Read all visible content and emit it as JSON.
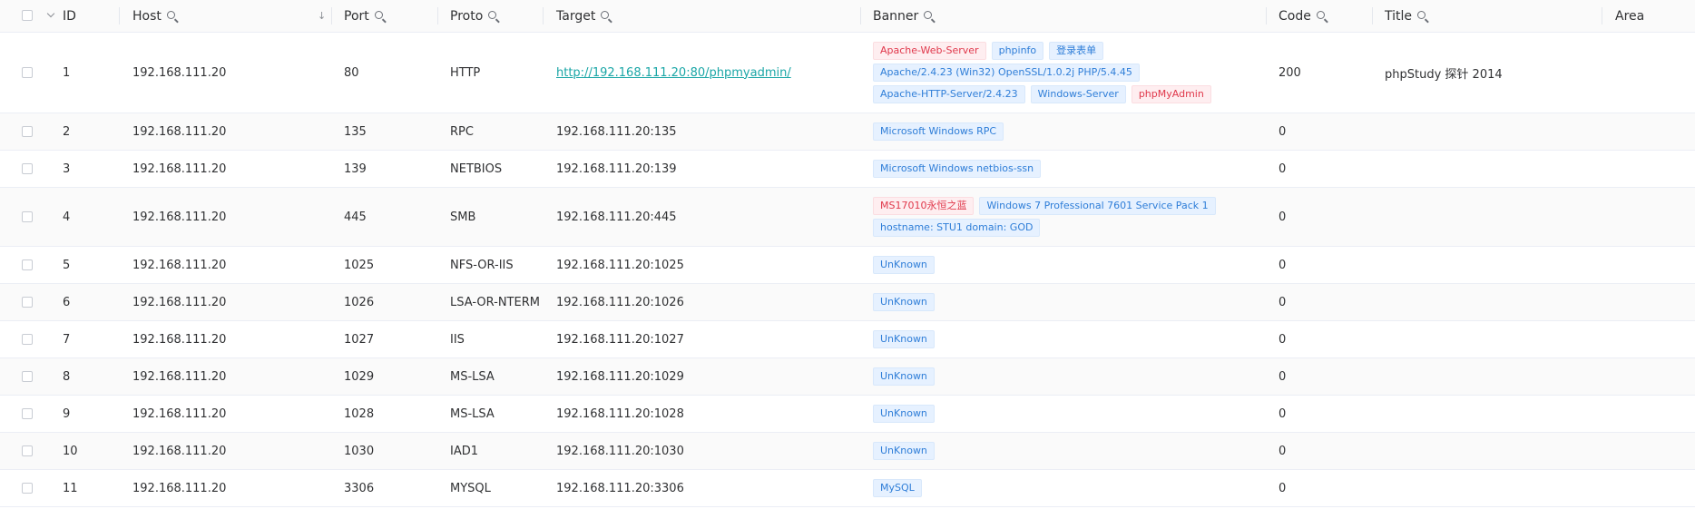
{
  "columns": {
    "id": "ID",
    "host": "Host",
    "port": "Port",
    "proto": "Proto",
    "target": "Target",
    "banner": "Banner",
    "code": "Code",
    "title": "Title",
    "area": "Area"
  },
  "colors": {
    "link": "#1aa6a6",
    "tag_blue_text": "#2f7ed8",
    "tag_blue_bg": "#e6f1ff",
    "tag_red_text": "#e0384b",
    "tag_red_bg": "#feeef0"
  },
  "icons": {
    "column_search": "search-icon",
    "sort": "sort-down-arrow-icon",
    "expand": "chevron-down-icon"
  },
  "rows": [
    {
      "id": "1",
      "host": "192.168.111.20",
      "port": "80",
      "proto": "HTTP",
      "target": "http://192.168.111.20:80/phpmyadmin/",
      "target_is_link": true,
      "banner": [
        {
          "text": "Apache-Web-Server",
          "color": "red"
        },
        {
          "text": "phpinfo",
          "color": "blue"
        },
        {
          "text": "登录表单",
          "color": "blue"
        },
        {
          "text": "Apache/2.4.23 (Win32) OpenSSL/1.0.2j PHP/5.4.45",
          "color": "blue"
        },
        {
          "text": "Apache-HTTP-Server/2.4.23",
          "color": "blue"
        },
        {
          "text": "Windows-Server",
          "color": "blue"
        },
        {
          "text": "phpMyAdmin",
          "color": "red"
        }
      ],
      "code": "200",
      "title": "phpStudy 探针 2014",
      "area": ""
    },
    {
      "id": "2",
      "host": "192.168.111.20",
      "port": "135",
      "proto": "RPC",
      "target": "192.168.111.20:135",
      "target_is_link": false,
      "banner": [
        {
          "text": "Microsoft Windows RPC",
          "color": "blue"
        }
      ],
      "code": "0",
      "title": "",
      "area": ""
    },
    {
      "id": "3",
      "host": "192.168.111.20",
      "port": "139",
      "proto": "NETBIOS",
      "target": "192.168.111.20:139",
      "target_is_link": false,
      "banner": [
        {
          "text": "Microsoft Windows netbios-ssn",
          "color": "blue"
        }
      ],
      "code": "0",
      "title": "",
      "area": ""
    },
    {
      "id": "4",
      "host": "192.168.111.20",
      "port": "445",
      "proto": "SMB",
      "target": "192.168.111.20:445",
      "target_is_link": false,
      "banner": [
        {
          "text": "MS17010永恒之蓝",
          "color": "red"
        },
        {
          "text": "Windows 7 Professional 7601 Service Pack 1",
          "color": "blue"
        },
        {
          "text": "hostname: STU1 domain: GOD",
          "color": "blue"
        }
      ],
      "code": "0",
      "title": "",
      "area": ""
    },
    {
      "id": "5",
      "host": "192.168.111.20",
      "port": "1025",
      "proto": "NFS-OR-IIS",
      "target": "192.168.111.20:1025",
      "target_is_link": false,
      "banner": [
        {
          "text": "UnKnown",
          "color": "blue"
        }
      ],
      "code": "0",
      "title": "",
      "area": ""
    },
    {
      "id": "6",
      "host": "192.168.111.20",
      "port": "1026",
      "proto": "LSA-OR-NTERM",
      "target": "192.168.111.20:1026",
      "target_is_link": false,
      "banner": [
        {
          "text": "UnKnown",
          "color": "blue"
        }
      ],
      "code": "0",
      "title": "",
      "area": ""
    },
    {
      "id": "7",
      "host": "192.168.111.20",
      "port": "1027",
      "proto": "IIS",
      "target": "192.168.111.20:1027",
      "target_is_link": false,
      "banner": [
        {
          "text": "UnKnown",
          "color": "blue"
        }
      ],
      "code": "0",
      "title": "",
      "area": ""
    },
    {
      "id": "8",
      "host": "192.168.111.20",
      "port": "1029",
      "proto": "MS-LSA",
      "target": "192.168.111.20:1029",
      "target_is_link": false,
      "banner": [
        {
          "text": "UnKnown",
          "color": "blue"
        }
      ],
      "code": "0",
      "title": "",
      "area": ""
    },
    {
      "id": "9",
      "host": "192.168.111.20",
      "port": "1028",
      "proto": "MS-LSA",
      "target": "192.168.111.20:1028",
      "target_is_link": false,
      "banner": [
        {
          "text": "UnKnown",
          "color": "blue"
        }
      ],
      "code": "0",
      "title": "",
      "area": ""
    },
    {
      "id": "10",
      "host": "192.168.111.20",
      "port": "1030",
      "proto": "IAD1",
      "target": "192.168.111.20:1030",
      "target_is_link": false,
      "banner": [
        {
          "text": "UnKnown",
          "color": "blue"
        }
      ],
      "code": "0",
      "title": "",
      "area": ""
    },
    {
      "id": "11",
      "host": "192.168.111.20",
      "port": "3306",
      "proto": "MYSQL",
      "target": "192.168.111.20:3306",
      "target_is_link": false,
      "banner": [
        {
          "text": "MySQL",
          "color": "blue"
        }
      ],
      "code": "0",
      "title": "",
      "area": ""
    }
  ]
}
